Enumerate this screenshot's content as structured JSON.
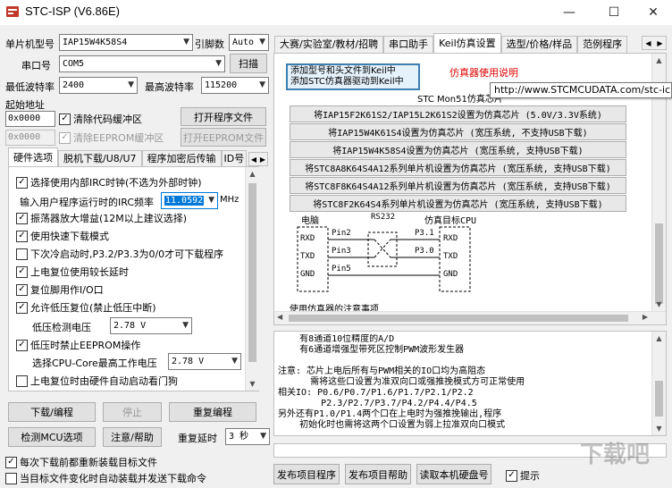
{
  "window": {
    "title": "STC-ISP (V6.86E)",
    "minimize": "—",
    "maximize": "☐",
    "close": "✕"
  },
  "left": {
    "mcu_label": "单片机型号",
    "mcu_value": "IAP15W4K58S4",
    "pins_label": "引脚数",
    "pins_value": "Auto",
    "port_label": "串口号",
    "port_value": "COM5",
    "scan_button": "扫描",
    "min_baud_label": "最低波特率",
    "min_baud_value": "2400",
    "max_baud_label": "最高波特率",
    "max_baud_value": "115200",
    "start_addr_label": "起始地址",
    "addr1": "0x0000",
    "clear_code_label": "清除代码缓冲区",
    "open_program_button": "打开程序文件",
    "addr2": "0x0000",
    "clear_eeprom_label": "清除EEPROM缓冲区",
    "open_eeprom_button": "打开EEPROM文件",
    "tabs": [
      "硬件选项",
      "脱机下载/U8/U7",
      "程序加密后传输",
      "ID号"
    ],
    "options": {
      "opt1": "选择使用内部IRC时钟(不选为外部时钟)",
      "irc_label": "输入用户程序运行时的IRC频率",
      "irc_value": "11.0592",
      "irc_unit": "MHz",
      "opt2": "振荡器放大增益(12M以上建议选择)",
      "opt3": "使用快速下载模式",
      "opt4": "下次冷启动时,P3.2/P3.3为0/0才可下载程序",
      "opt5": "上电复位使用较长延时",
      "opt6": "复位脚用作I/O口",
      "opt7": "允许低压复位(禁止低压中断)",
      "lv_label": "低压检测电压",
      "lv_value": "2.78 V",
      "opt8": "低压时禁止EEPROM操作",
      "cpu_label": "选择CPU-Core最高工作电压",
      "cpu_value": "2.78 V",
      "opt9": "上电复位时由硬件自动启动看门狗"
    },
    "buttons": {
      "download": "下载/编程",
      "stop": "停止",
      "redownload": "重复编程",
      "detect": "检测MCU选项",
      "help": "注意/帮助",
      "delay_label": "重复延时",
      "delay_value": "3 秒"
    },
    "bottom_check1": "每次下载前都重新装载目标文件",
    "bottom_check2": "当目标文件变化时自动装载并发送下载命令"
  },
  "right": {
    "tabs": [
      "大赛/实验室/教材/招聘",
      "串口助手",
      "Keil仿真设置",
      "选型/价格/样品",
      "范例程序"
    ],
    "add_keil_button": "添加型号和头文件到Keil中\n添加STC仿真器驱动到Keil中",
    "emulator_link": "仿真器使用说明",
    "tooltip": "http://www.STCMCUDATA.com/stc-ic",
    "mon51_label": "STC Mon51仿真芯片",
    "chip_buttons": [
      "将IAP15F2K61S2/IAP15L2K61S2设置为仿真芯片 (5.0V/3.3V系统)",
      "将IAP15W4K61S4设置为仿真芯片 (宽压系统, 不支持USB下载)",
      "将IAP15W4K58S4设置为仿真芯片 (宽压系统, 支持USB下载)",
      "将STC8A8K64S4A12系列单片机设置为仿真芯片 (宽压系统, 支持USB下载)",
      "将STC8F8K64S4A12系列单片机设置为仿真芯片 (宽压系统, 支持USB下载)",
      "将STC8F2K64S4系列单片机设置为仿真芯片 (宽压系统, 支持USB下载)"
    ],
    "diagram": {
      "pc": "电脑",
      "rs232": "RS232",
      "target": "仿真目标CPU",
      "rxd": "RXD",
      "txd": "TXD",
      "gnd": "GND",
      "pin2": "Pin2",
      "pin3": "Pin3",
      "pin5": "Pin5",
      "p31": "P3.1",
      "p30": "P3.0",
      "trxd": "RXD",
      "ttxd": "TXD",
      "tgnd": "GND",
      "cut": "使用仿真器的注意事项"
    },
    "log": "    有8通道10位精度的A/D\n    有6通道增强型带死区控制PWM波形发生器\n\n注意: 芯片上电后所有与PWM相关的IO口均为高阻态\n      需将这些口设置为准双向口或强推挽模式方可正常使用\n相关IO: P0.6/P0.7/P1.6/P1.7/P2.1/P2.2\n        P2.3/P2.7/P3.7/P4.2/P4.4/P4.5\n另外还有P1.0/P1.4两个口在上电时为强推挽输出,程序\n    初始化时也需将这两个口设置为弱上拉准双向口模式",
    "bottom_buttons": [
      "发布项目程序",
      "发布项目帮助",
      "读取本机硬盘号"
    ],
    "hint_label": "提示",
    "watermark": "下载吧"
  },
  "colors": {
    "link": "#e00000",
    "selected": "#0078d7",
    "highlight_box": "#3c7fb1"
  }
}
